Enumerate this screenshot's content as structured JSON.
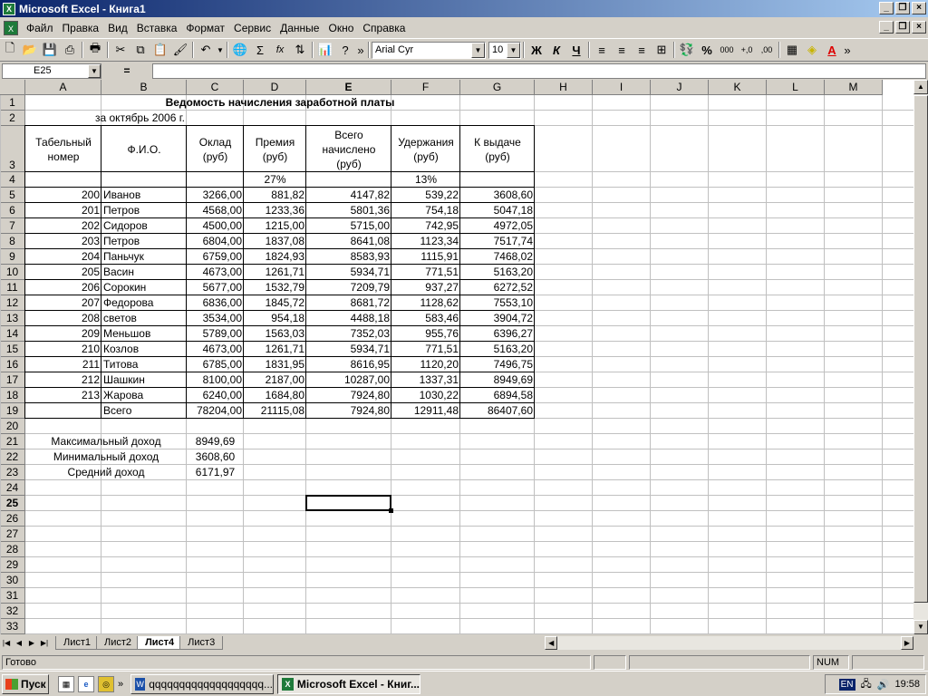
{
  "window": {
    "title": "Microsoft Excel - Книга1"
  },
  "menu": [
    "Файл",
    "Правка",
    "Вид",
    "Вставка",
    "Формат",
    "Сервис",
    "Данные",
    "Окно",
    "Справка"
  ],
  "toolbar": {
    "font": "Arial Cyr",
    "size": "10",
    "bold": "Ж",
    "italic": "К",
    "underline": "Ч",
    "percent": "%",
    "thousands": "000",
    "sum": "Σ",
    "fx": "fx"
  },
  "formula": {
    "namebox": "E25",
    "eq": "=",
    "content": ""
  },
  "columns": [
    "A",
    "B",
    "C",
    "D",
    "E",
    "F",
    "G",
    "H",
    "I",
    "J",
    "K",
    "L",
    "M"
  ],
  "rows": [
    "1",
    "2",
    "3",
    "4",
    "5",
    "6",
    "7",
    "8",
    "9",
    "10",
    "11",
    "12",
    "13",
    "14",
    "15",
    "16",
    "17",
    "18",
    "19",
    "20",
    "21",
    "22",
    "23",
    "24",
    "25",
    "26",
    "27",
    "28",
    "29",
    "30",
    "31",
    "32",
    "33"
  ],
  "sheet": {
    "title": "Ведомость начисления заработной платы",
    "subtitle": "за октябрь 2006 г.",
    "headers": {
      "a": [
        "Табельный",
        "номер"
      ],
      "b": "Ф.И.О.",
      "c": [
        "Оклад",
        "(руб)"
      ],
      "d": [
        "Премия",
        "(руб)"
      ],
      "e": [
        "Всего",
        "начислено",
        "(руб)"
      ],
      "f": [
        "Удержания",
        "(руб)"
      ],
      "g": [
        "К выдаче",
        "(руб)"
      ]
    },
    "premium_rate": "27%",
    "deduction_rate": "13%",
    "data": [
      [
        "200",
        "Иванов",
        "3266,00",
        "881,82",
        "4147,82",
        "539,22",
        "3608,60"
      ],
      [
        "201",
        "Петров",
        "4568,00",
        "1233,36",
        "5801,36",
        "754,18",
        "5047,18"
      ],
      [
        "202",
        "Сидоров",
        "4500,00",
        "1215,00",
        "5715,00",
        "742,95",
        "4972,05"
      ],
      [
        "203",
        "Петров",
        "6804,00",
        "1837,08",
        "8641,08",
        "1123,34",
        "7517,74"
      ],
      [
        "204",
        "Паньчук",
        "6759,00",
        "1824,93",
        "8583,93",
        "1115,91",
        "7468,02"
      ],
      [
        "205",
        "Васин",
        "4673,00",
        "1261,71",
        "5934,71",
        "771,51",
        "5163,20"
      ],
      [
        "206",
        "Сорокин",
        "5677,00",
        "1532,79",
        "7209,79",
        "937,27",
        "6272,52"
      ],
      [
        "207",
        "Федорова",
        "6836,00",
        "1845,72",
        "8681,72",
        "1128,62",
        "7553,10"
      ],
      [
        "208",
        "светов",
        "3534,00",
        "954,18",
        "4488,18",
        "583,46",
        "3904,72"
      ],
      [
        "209",
        "Меньшов",
        "5789,00",
        "1563,03",
        "7352,03",
        "955,76",
        "6396,27"
      ],
      [
        "210",
        "Козлов",
        "4673,00",
        "1261,71",
        "5934,71",
        "771,51",
        "5163,20"
      ],
      [
        "211",
        "Титова",
        "6785,00",
        "1831,95",
        "8616,95",
        "1120,20",
        "7496,75"
      ],
      [
        "212",
        "Шашкин",
        "8100,00",
        "2187,00",
        "10287,00",
        "1337,31",
        "8949,69"
      ],
      [
        "213",
        "Жарова",
        "6240,00",
        "1684,80",
        "7924,80",
        "1030,22",
        "6894,58"
      ]
    ],
    "total": [
      "",
      "Всего",
      "78204,00",
      "21115,08",
      "7924,80",
      "12911,48",
      "86407,60"
    ],
    "summary": [
      {
        "label": "Максимальный доход",
        "value": "8949,69"
      },
      {
        "label": "Минимальный доход",
        "value": "3608,60"
      },
      {
        "label": "Средний доход",
        "value": "6171,97"
      }
    ]
  },
  "tabs": [
    "Лист1",
    "Лист2",
    "Лист4",
    "Лист3"
  ],
  "active_tab": "Лист4",
  "status": {
    "text": "Готово",
    "num": "NUM"
  },
  "taskbar": {
    "start": "Пуск",
    "tasks": [
      "qqqqqqqqqqqqqqqqqqq...",
      "Microsoft Excel - Книг..."
    ],
    "lang": "EN",
    "time": "19:58"
  }
}
